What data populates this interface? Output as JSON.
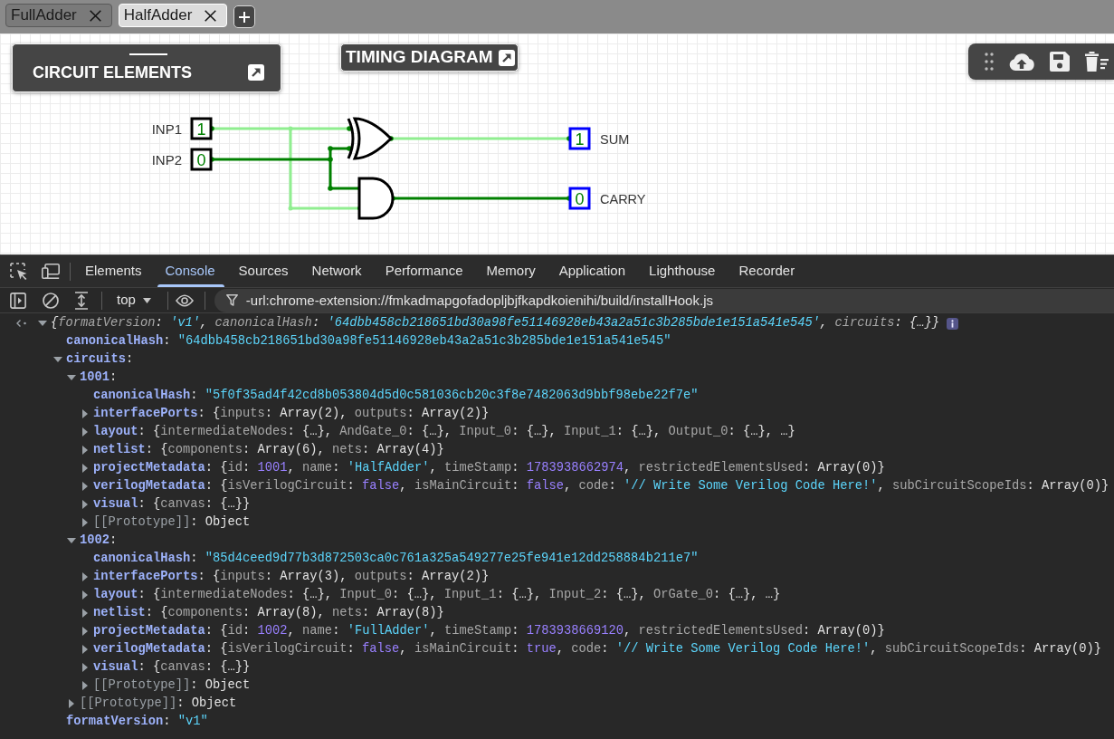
{
  "tabs": [
    {
      "label": "FullAdder",
      "selected": false
    },
    {
      "label": "HalfAdder",
      "selected": true
    }
  ],
  "panels": {
    "circuit_elements": {
      "title": "CIRCUIT ELEMENTS"
    },
    "timing_diagram": {
      "title": "TIMING DIAGRAM"
    }
  },
  "circuit": {
    "inputs": [
      {
        "label": "INP1",
        "value": "1"
      },
      {
        "label": "INP2",
        "value": "0"
      }
    ],
    "gates": [
      {
        "kind": "xor"
      },
      {
        "kind": "and"
      }
    ],
    "outputs": [
      {
        "label": "SUM",
        "value": "1"
      },
      {
        "label": "CARRY",
        "value": "0"
      }
    ],
    "nets": [
      {
        "high": true
      },
      {
        "high": false
      },
      {
        "high": true
      },
      {
        "high": false
      }
    ]
  },
  "devtools": {
    "tabs": [
      {
        "label": "Elements",
        "selected": false
      },
      {
        "label": "Console",
        "selected": true
      },
      {
        "label": "Sources",
        "selected": false
      },
      {
        "label": "Network",
        "selected": false
      },
      {
        "label": "Performance",
        "selected": false
      },
      {
        "label": "Memory",
        "selected": false
      },
      {
        "label": "Application",
        "selected": false
      },
      {
        "label": "Lighthouse",
        "selected": false
      },
      {
        "label": "Recorder",
        "selected": false
      }
    ],
    "context": "top",
    "filter": {
      "value": "-url:chrome-extension://fmkadmapgofadopljbjfkapdkoienihi/build/installHook.js"
    },
    "console": {
      "entries": [
        {
          "kind": "root",
          "expanded": true,
          "tokens": [
            {
              "kind": "plain",
              "text": "{"
            },
            {
              "kind": "dim",
              "text": "formatVersion"
            },
            {
              "kind": "plain",
              "text": ": "
            },
            {
              "kind": "string",
              "text": "'v1'"
            },
            {
              "kind": "plain",
              "text": ", "
            },
            {
              "kind": "dim",
              "text": "canonicalHash"
            },
            {
              "kind": "plain",
              "text": ": "
            },
            {
              "kind": "string",
              "text": "'64dbb458cb218651bd30a98fe51146928eb43a2a51c3b285bde1e151a541e545'"
            },
            {
              "kind": "plain",
              "text": ", "
            },
            {
              "kind": "dim",
              "text": "circuits"
            },
            {
              "kind": "plain",
              "text": ": {…}}"
            }
          ],
          "children": [
            {
              "kind": "leaf",
              "tokens": [
                {
                  "kind": "key",
                  "text": "canonicalHash"
                },
                {
                  "kind": "plain",
                  "text": ": "
                },
                {
                  "kind": "string",
                  "text": "\"64dbb458cb218651bd30a98fe51146928eb43a2a51c3b285bde1e151a541e545\""
                }
              ]
            },
            {
              "kind": "object",
              "expanded": true,
              "tokens": [
                {
                  "kind": "key",
                  "text": "circuits"
                },
                {
                  "kind": "plain",
                  "text": ":"
                }
              ],
              "children": [
                {
                  "kind": "object",
                  "expanded": true,
                  "tokens": [
                    {
                      "kind": "key",
                      "text": "1001"
                    },
                    {
                      "kind": "plain",
                      "text": ":"
                    }
                  ],
                  "children": [
                    {
                      "kind": "leaf",
                      "tokens": [
                        {
                          "kind": "key",
                          "text": "canonicalHash"
                        },
                        {
                          "kind": "plain",
                          "text": ": "
                        },
                        {
                          "kind": "string",
                          "text": "\"5f0f35ad4f42cd8b053804d5d0c581036cb20c3f8e7482063d9bbf98ebe22f7e\""
                        }
                      ]
                    },
                    {
                      "kind": "object",
                      "expanded": false,
                      "tokens": [
                        {
                          "kind": "key",
                          "text": "interfacePorts"
                        },
                        {
                          "kind": "plain",
                          "text": ": {"
                        },
                        {
                          "kind": "dim",
                          "text": "inputs"
                        },
                        {
                          "kind": "plain",
                          "text": ": Array(2), "
                        },
                        {
                          "kind": "dim",
                          "text": "outputs"
                        },
                        {
                          "kind": "plain",
                          "text": ": Array(2)}"
                        }
                      ]
                    },
                    {
                      "kind": "object",
                      "expanded": false,
                      "tokens": [
                        {
                          "kind": "key",
                          "text": "layout"
                        },
                        {
                          "kind": "plain",
                          "text": ": {"
                        },
                        {
                          "kind": "dim",
                          "text": "intermediateNodes"
                        },
                        {
                          "kind": "plain",
                          "text": ": {…}, "
                        },
                        {
                          "kind": "dim",
                          "text": "AndGate_0"
                        },
                        {
                          "kind": "plain",
                          "text": ": {…}, "
                        },
                        {
                          "kind": "dim",
                          "text": "Input_0"
                        },
                        {
                          "kind": "plain",
                          "text": ": {…}, "
                        },
                        {
                          "kind": "dim",
                          "text": "Input_1"
                        },
                        {
                          "kind": "plain",
                          "text": ": {…}, "
                        },
                        {
                          "kind": "dim",
                          "text": "Output_0"
                        },
                        {
                          "kind": "plain",
                          "text": ": {…}, …}"
                        }
                      ]
                    },
                    {
                      "kind": "object",
                      "expanded": false,
                      "tokens": [
                        {
                          "kind": "key",
                          "text": "netlist"
                        },
                        {
                          "kind": "plain",
                          "text": ": {"
                        },
                        {
                          "kind": "dim",
                          "text": "components"
                        },
                        {
                          "kind": "plain",
                          "text": ": Array(6), "
                        },
                        {
                          "kind": "dim",
                          "text": "nets"
                        },
                        {
                          "kind": "plain",
                          "text": ": Array(4)}"
                        }
                      ]
                    },
                    {
                      "kind": "object",
                      "expanded": false,
                      "tokens": [
                        {
                          "kind": "key",
                          "text": "projectMetadata"
                        },
                        {
                          "kind": "plain",
                          "text": ": {"
                        },
                        {
                          "kind": "dim",
                          "text": "id"
                        },
                        {
                          "kind": "plain",
                          "text": ": "
                        },
                        {
                          "kind": "number",
                          "text": "1001"
                        },
                        {
                          "kind": "plain",
                          "text": ", "
                        },
                        {
                          "kind": "dim",
                          "text": "name"
                        },
                        {
                          "kind": "plain",
                          "text": ": "
                        },
                        {
                          "kind": "string",
                          "text": "'HalfAdder'"
                        },
                        {
                          "kind": "plain",
                          "text": ", "
                        },
                        {
                          "kind": "dim",
                          "text": "timeStamp"
                        },
                        {
                          "kind": "plain",
                          "text": ": "
                        },
                        {
                          "kind": "number",
                          "text": "1783938662974"
                        },
                        {
                          "kind": "plain",
                          "text": ", "
                        },
                        {
                          "kind": "dim",
                          "text": "restrictedElementsUsed"
                        },
                        {
                          "kind": "plain",
                          "text": ": Array(0)}"
                        }
                      ]
                    },
                    {
                      "kind": "object",
                      "expanded": false,
                      "tokens": [
                        {
                          "kind": "key",
                          "text": "verilogMetadata"
                        },
                        {
                          "kind": "plain",
                          "text": ": {"
                        },
                        {
                          "kind": "dim",
                          "text": "isVerilogCircuit"
                        },
                        {
                          "kind": "plain",
                          "text": ": "
                        },
                        {
                          "kind": "keyword",
                          "text": "false"
                        },
                        {
                          "kind": "plain",
                          "text": ", "
                        },
                        {
                          "kind": "dim",
                          "text": "isMainCircuit"
                        },
                        {
                          "kind": "plain",
                          "text": ": "
                        },
                        {
                          "kind": "keyword",
                          "text": "false"
                        },
                        {
                          "kind": "plain",
                          "text": ", "
                        },
                        {
                          "kind": "dim",
                          "text": "code"
                        },
                        {
                          "kind": "plain",
                          "text": ": "
                        },
                        {
                          "kind": "string",
                          "text": "'// Write Some Verilog Code Here!'"
                        },
                        {
                          "kind": "plain",
                          "text": ", "
                        },
                        {
                          "kind": "dim",
                          "text": "subCircuitScopeIds"
                        },
                        {
                          "kind": "plain",
                          "text": ": Array(0)}"
                        }
                      ]
                    },
                    {
                      "kind": "object",
                      "expanded": false,
                      "tokens": [
                        {
                          "kind": "key",
                          "text": "visual"
                        },
                        {
                          "kind": "plain",
                          "text": ": {"
                        },
                        {
                          "kind": "dim",
                          "text": "canvas"
                        },
                        {
                          "kind": "plain",
                          "text": ": {…}}"
                        }
                      ]
                    },
                    {
                      "kind": "object",
                      "expanded": false,
                      "tokens": [
                        {
                          "kind": "internal",
                          "text": "[[Prototype]]"
                        },
                        {
                          "kind": "plain",
                          "text": ": Object"
                        }
                      ]
                    }
                  ]
                },
                {
                  "kind": "object",
                  "expanded": true,
                  "tokens": [
                    {
                      "kind": "key",
                      "text": "1002"
                    },
                    {
                      "kind": "plain",
                      "text": ":"
                    }
                  ],
                  "children": [
                    {
                      "kind": "leaf",
                      "tokens": [
                        {
                          "kind": "key",
                          "text": "canonicalHash"
                        },
                        {
                          "kind": "plain",
                          "text": ": "
                        },
                        {
                          "kind": "string",
                          "text": "\"85d4ceed9d77b3d872503ca0c761a325a549277e25fe941e12dd258884b211e7\""
                        }
                      ]
                    },
                    {
                      "kind": "object",
                      "expanded": false,
                      "tokens": [
                        {
                          "kind": "key",
                          "text": "interfacePorts"
                        },
                        {
                          "kind": "plain",
                          "text": ": {"
                        },
                        {
                          "kind": "dim",
                          "text": "inputs"
                        },
                        {
                          "kind": "plain",
                          "text": ": Array(3), "
                        },
                        {
                          "kind": "dim",
                          "text": "outputs"
                        },
                        {
                          "kind": "plain",
                          "text": ": Array(2)}"
                        }
                      ]
                    },
                    {
                      "kind": "object",
                      "expanded": false,
                      "tokens": [
                        {
                          "kind": "key",
                          "text": "layout"
                        },
                        {
                          "kind": "plain",
                          "text": ": {"
                        },
                        {
                          "kind": "dim",
                          "text": "intermediateNodes"
                        },
                        {
                          "kind": "plain",
                          "text": ": {…}, "
                        },
                        {
                          "kind": "dim",
                          "text": "Input_0"
                        },
                        {
                          "kind": "plain",
                          "text": ": {…}, "
                        },
                        {
                          "kind": "dim",
                          "text": "Input_1"
                        },
                        {
                          "kind": "plain",
                          "text": ": {…}, "
                        },
                        {
                          "kind": "dim",
                          "text": "Input_2"
                        },
                        {
                          "kind": "plain",
                          "text": ": {…}, "
                        },
                        {
                          "kind": "dim",
                          "text": "OrGate_0"
                        },
                        {
                          "kind": "plain",
                          "text": ": {…}, …}"
                        }
                      ]
                    },
                    {
                      "kind": "object",
                      "expanded": false,
                      "tokens": [
                        {
                          "kind": "key",
                          "text": "netlist"
                        },
                        {
                          "kind": "plain",
                          "text": ": {"
                        },
                        {
                          "kind": "dim",
                          "text": "components"
                        },
                        {
                          "kind": "plain",
                          "text": ": Array(8), "
                        },
                        {
                          "kind": "dim",
                          "text": "nets"
                        },
                        {
                          "kind": "plain",
                          "text": ": Array(8)}"
                        }
                      ]
                    },
                    {
                      "kind": "object",
                      "expanded": false,
                      "tokens": [
                        {
                          "kind": "key",
                          "text": "projectMetadata"
                        },
                        {
                          "kind": "plain",
                          "text": ": {"
                        },
                        {
                          "kind": "dim",
                          "text": "id"
                        },
                        {
                          "kind": "plain",
                          "text": ": "
                        },
                        {
                          "kind": "number",
                          "text": "1002"
                        },
                        {
                          "kind": "plain",
                          "text": ", "
                        },
                        {
                          "kind": "dim",
                          "text": "name"
                        },
                        {
                          "kind": "plain",
                          "text": ": "
                        },
                        {
                          "kind": "string",
                          "text": "'FullAdder'"
                        },
                        {
                          "kind": "plain",
                          "text": ", "
                        },
                        {
                          "kind": "dim",
                          "text": "timeStamp"
                        },
                        {
                          "kind": "plain",
                          "text": ": "
                        },
                        {
                          "kind": "number",
                          "text": "1783938669120"
                        },
                        {
                          "kind": "plain",
                          "text": ", "
                        },
                        {
                          "kind": "dim",
                          "text": "restrictedElementsUsed"
                        },
                        {
                          "kind": "plain",
                          "text": ": Array(0)}"
                        }
                      ]
                    },
                    {
                      "kind": "object",
                      "expanded": false,
                      "tokens": [
                        {
                          "kind": "key",
                          "text": "verilogMetadata"
                        },
                        {
                          "kind": "plain",
                          "text": ": {"
                        },
                        {
                          "kind": "dim",
                          "text": "isVerilogCircuit"
                        },
                        {
                          "kind": "plain",
                          "text": ": "
                        },
                        {
                          "kind": "keyword",
                          "text": "false"
                        },
                        {
                          "kind": "plain",
                          "text": ", "
                        },
                        {
                          "kind": "dim",
                          "text": "isMainCircuit"
                        },
                        {
                          "kind": "plain",
                          "text": ": "
                        },
                        {
                          "kind": "keyword",
                          "text": "true"
                        },
                        {
                          "kind": "plain",
                          "text": ", "
                        },
                        {
                          "kind": "dim",
                          "text": "code"
                        },
                        {
                          "kind": "plain",
                          "text": ": "
                        },
                        {
                          "kind": "string",
                          "text": "'// Write Some Verilog Code Here!'"
                        },
                        {
                          "kind": "plain",
                          "text": ", "
                        },
                        {
                          "kind": "dim",
                          "text": "subCircuitScopeIds"
                        },
                        {
                          "kind": "plain",
                          "text": ": Array(0)}"
                        }
                      ]
                    },
                    {
                      "kind": "object",
                      "expanded": false,
                      "tokens": [
                        {
                          "kind": "key",
                          "text": "visual"
                        },
                        {
                          "kind": "plain",
                          "text": ": {"
                        },
                        {
                          "kind": "dim",
                          "text": "canvas"
                        },
                        {
                          "kind": "plain",
                          "text": ": {…}}"
                        }
                      ]
                    },
                    {
                      "kind": "object",
                      "expanded": false,
                      "tokens": [
                        {
                          "kind": "internal",
                          "text": "[[Prototype]]"
                        },
                        {
                          "kind": "plain",
                          "text": ": Object"
                        }
                      ]
                    }
                  ]
                },
                {
                  "kind": "object",
                  "expanded": false,
                  "tokens": [
                    {
                      "kind": "internal",
                      "text": "[[Prototype]]"
                    },
                    {
                      "kind": "plain",
                      "text": ": Object"
                    }
                  ]
                }
              ]
            },
            {
              "kind": "leaf",
              "tokens": [
                {
                  "kind": "key",
                  "text": "formatVersion"
                },
                {
                  "kind": "plain",
                  "text": ": "
                },
                {
                  "kind": "string",
                  "text": "\"v1\""
                }
              ]
            }
          ]
        }
      ]
    }
  }
}
